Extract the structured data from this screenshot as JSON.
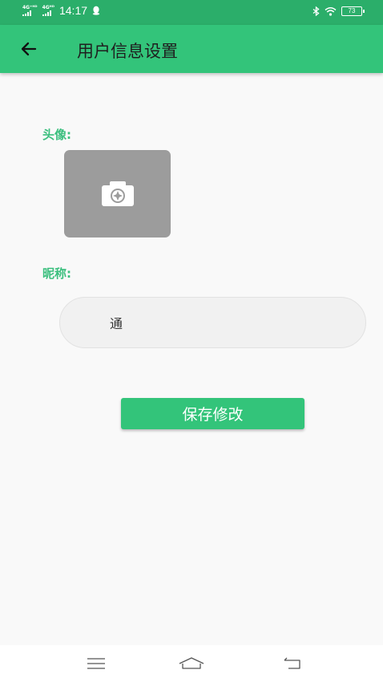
{
  "status_bar": {
    "sim1": "4G⁺ᴴᴰ",
    "sim2": "4Gᴴᴰ",
    "time": "14:17",
    "battery": "73",
    "icons": [
      "qq-notification-icon",
      "bluetooth-icon",
      "wifi-icon",
      "battery-icon"
    ]
  },
  "app_bar": {
    "title": "用户信息设置",
    "back_icon": "arrow-left-icon",
    "color": "#33c47a"
  },
  "avatar": {
    "label": "头像:",
    "icon": "camera-icon"
  },
  "nickname": {
    "label": "昵称:",
    "value": "通"
  },
  "save_button": {
    "label": "保存修改"
  },
  "nav_bar": {
    "icons": [
      "menu-icon",
      "home-icon",
      "back-icon"
    ]
  },
  "colors": {
    "accent": "#33c47a",
    "status_bar": "#2bae6a",
    "label": "#3bbf7e",
    "avatar_bg": "#9c9c9c"
  }
}
